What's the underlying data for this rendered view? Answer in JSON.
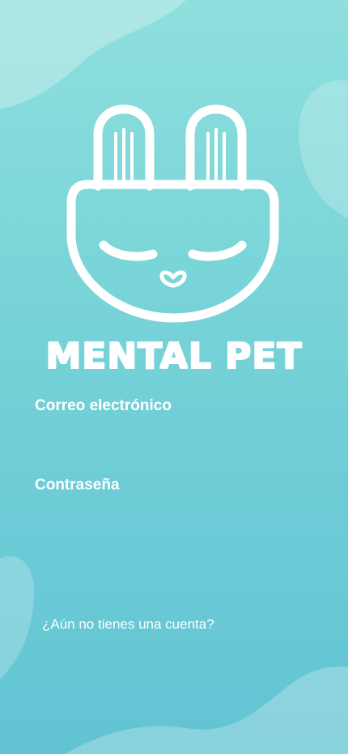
{
  "brand": {
    "name": "MENTAL PET",
    "logo_icon": "bunny-face-icon"
  },
  "form": {
    "email_label": "Correo electrónico",
    "email_value": "",
    "email_placeholder": "",
    "password_label": "Contraseña",
    "password_value": "",
    "password_placeholder": ""
  },
  "footer": {
    "signup_prompt": "¿Aún no tienes una cuenta?"
  },
  "colors": {
    "bg_top": "#8fdfdd",
    "bg_bottom": "#62c4d3",
    "text": "#ffffff"
  }
}
